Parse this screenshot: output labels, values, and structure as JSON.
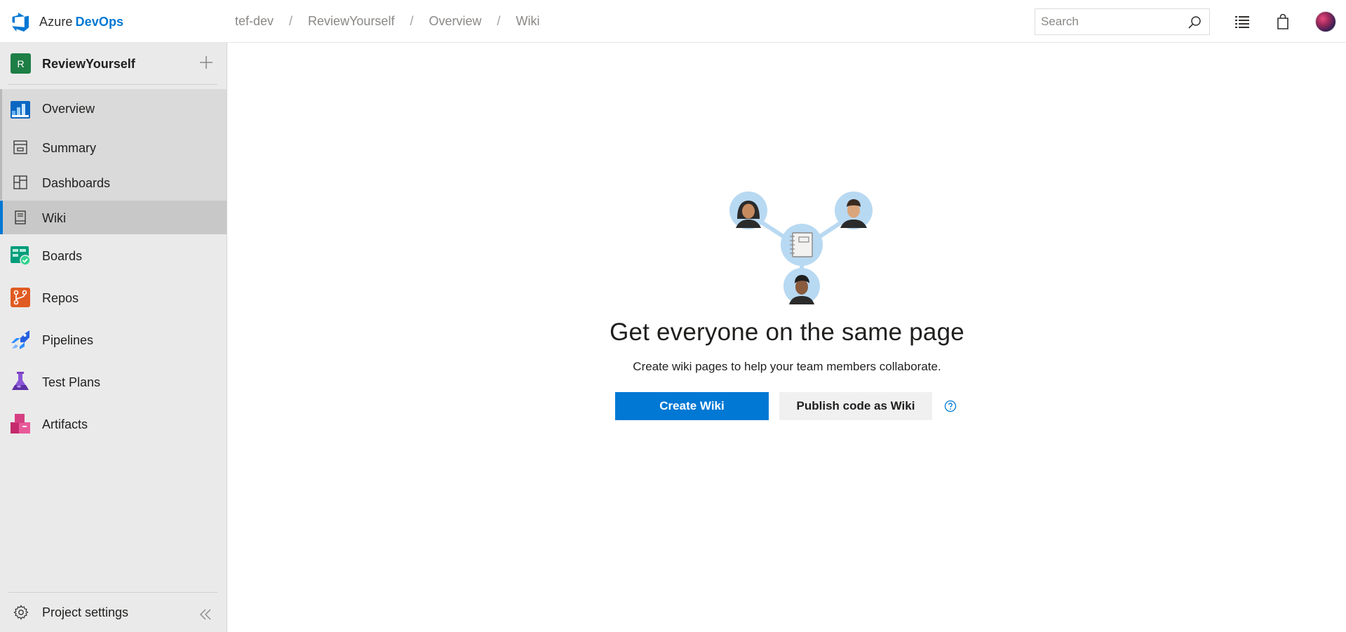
{
  "brand": {
    "name_part1": "Azure",
    "name_part2": "DevOps"
  },
  "breadcrumb": [
    "tef-dev",
    "ReviewYourself",
    "Overview",
    "Wiki"
  ],
  "breadcrumb_separator": "/",
  "search": {
    "placeholder": "Search"
  },
  "topbar_icons": [
    "search-icon",
    "list-icon",
    "shopping-bag-icon",
    "user-avatar"
  ],
  "project": {
    "badge": "R",
    "name": "ReviewYourself",
    "badge_color": "#1e7e46"
  },
  "sidebar": {
    "items": [
      {
        "label": "Overview",
        "icon": "overview-icon"
      },
      {
        "label": "Summary",
        "icon": "summary-icon"
      },
      {
        "label": "Dashboards",
        "icon": "dashboards-icon"
      },
      {
        "label": "Wiki",
        "icon": "wiki-icon",
        "active": true
      },
      {
        "label": "Boards",
        "icon": "boards-icon"
      },
      {
        "label": "Repos",
        "icon": "repos-icon"
      },
      {
        "label": "Pipelines",
        "icon": "pipelines-icon"
      },
      {
        "label": "Test Plans",
        "icon": "test-plans-icon"
      },
      {
        "label": "Artifacts",
        "icon": "artifacts-icon"
      }
    ],
    "settings_label": "Project settings"
  },
  "empty_state": {
    "title": "Get everyone on the same page",
    "subtitle": "Create wiki pages to help your team members collaborate.",
    "primary_button": "Create Wiki",
    "secondary_button": "Publish code as Wiki"
  },
  "colors": {
    "accent": "#0078d4",
    "sidebar_bg": "#eaeaea",
    "active_bg": "#c8c8c8"
  }
}
